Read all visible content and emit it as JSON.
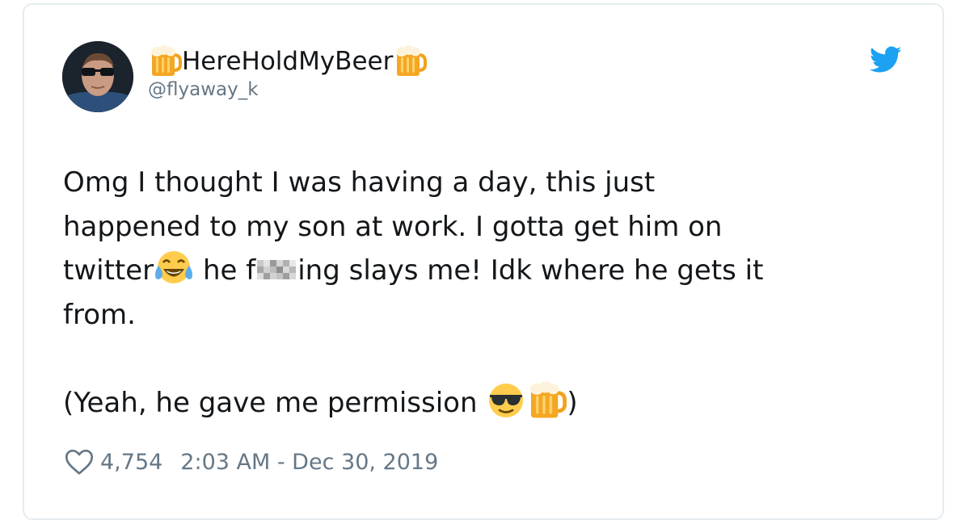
{
  "tweet": {
    "display_name": "HereHoldMyBeer",
    "handle": "@flyaway_k",
    "text": {
      "line1": "Omg I thought I was having a day, this just",
      "line2": "happened to my son at work. I gotta get him on",
      "line3_a": "twitter",
      "line3_b": " he f",
      "line3_c": "ing slays me! Idk where he gets it",
      "line4": "from.",
      "line5_a": "(Yeah, he gave me permission ",
      "line5_b": ")"
    },
    "likes": "4,754",
    "timestamp": "2:03 AM - Dec 30, 2019"
  },
  "icons": {
    "brand": "twitter-bird-icon",
    "like": "heart-outline-icon",
    "emojis": [
      "beer-mug-emoji",
      "tears-of-joy-emoji",
      "sunglasses-emoji"
    ]
  },
  "colors": {
    "twitter_blue": "#1da1f2",
    "text": "#14171a",
    "secondary_text": "#657786",
    "border": "#e6ecf0"
  }
}
